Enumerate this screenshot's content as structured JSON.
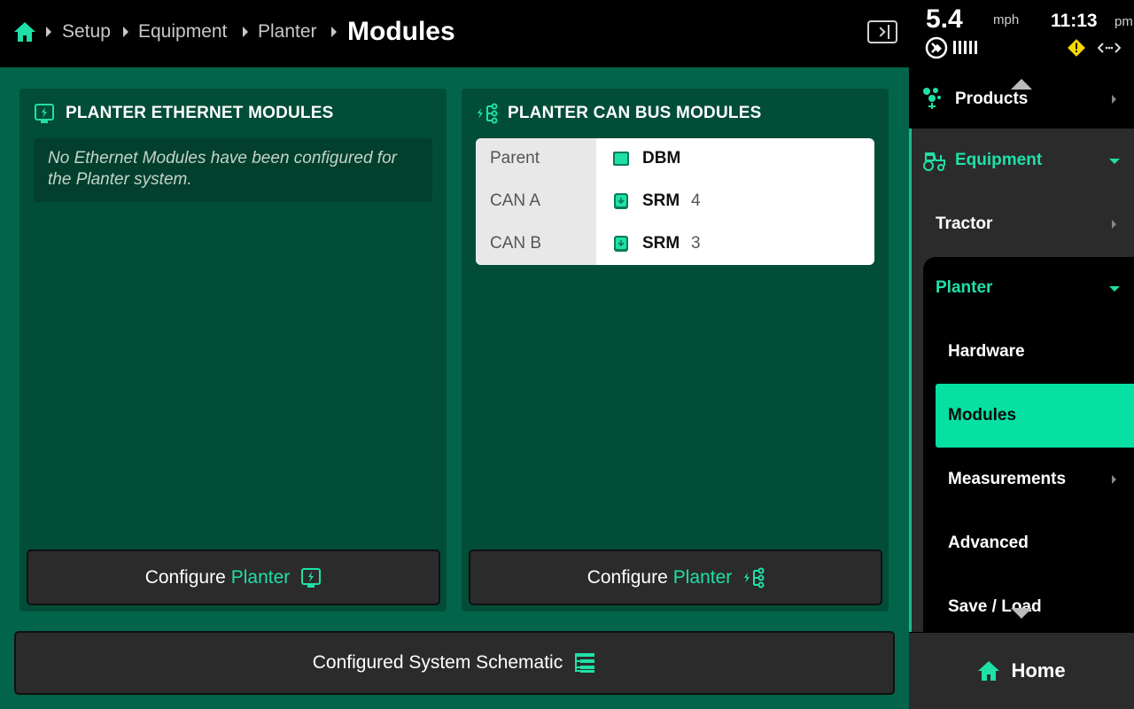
{
  "breadcrumb": {
    "items": [
      "Setup",
      "Equipment",
      "Planter"
    ],
    "current": "Modules"
  },
  "status": {
    "speed": "5.4",
    "speed_unit": "mph",
    "time": "11:13",
    "ampm": "pm"
  },
  "ethernet_card": {
    "title": "PLANTER ETHERNET MODULES",
    "empty_message": "No Ethernet Modules have been configured for the Planter system.",
    "button_text": "Configure",
    "button_accent": "Planter"
  },
  "canbus_card": {
    "title": "PLANTER CAN BUS MODULES",
    "rows": [
      {
        "label": "Parent",
        "module": "DBM",
        "count": ""
      },
      {
        "label": "CAN A",
        "module": "SRM",
        "count": "4"
      },
      {
        "label": "CAN B",
        "module": "SRM",
        "count": "3"
      }
    ],
    "button_text": "Configure",
    "button_accent": "Planter"
  },
  "schematic_button": "Configured System Schematic",
  "sidebar": {
    "products": "Products",
    "equipment": "Equipment",
    "tractor": "Tractor",
    "planter": "Planter",
    "hardware": "Hardware",
    "modules": "Modules",
    "measurements": "Measurements",
    "advanced": "Advanced",
    "save_load": "Save / Load",
    "home": "Home"
  },
  "colors": {
    "accent": "#1fe0a6",
    "main_bg": "#026549",
    "card_bg": "#014d37",
    "selected": "#06e0a3",
    "warning": "#f7d800"
  }
}
